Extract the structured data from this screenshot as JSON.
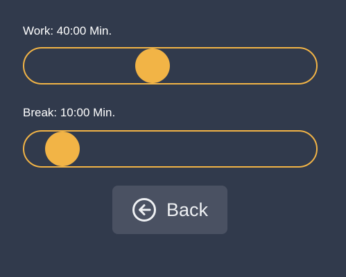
{
  "work": {
    "label": "Work: 40:00 Min.",
    "value_fraction": 0.44
  },
  "break": {
    "label": "Break: 10:00 Min.",
    "value_fraction": 0.13
  },
  "back_button": {
    "label": "Back",
    "icon": "arrow-left-circle-icon"
  },
  "colors": {
    "background": "#313a4c",
    "accent": "#f2b446",
    "button_bg": "#4a5162",
    "text": "#ffffff"
  }
}
